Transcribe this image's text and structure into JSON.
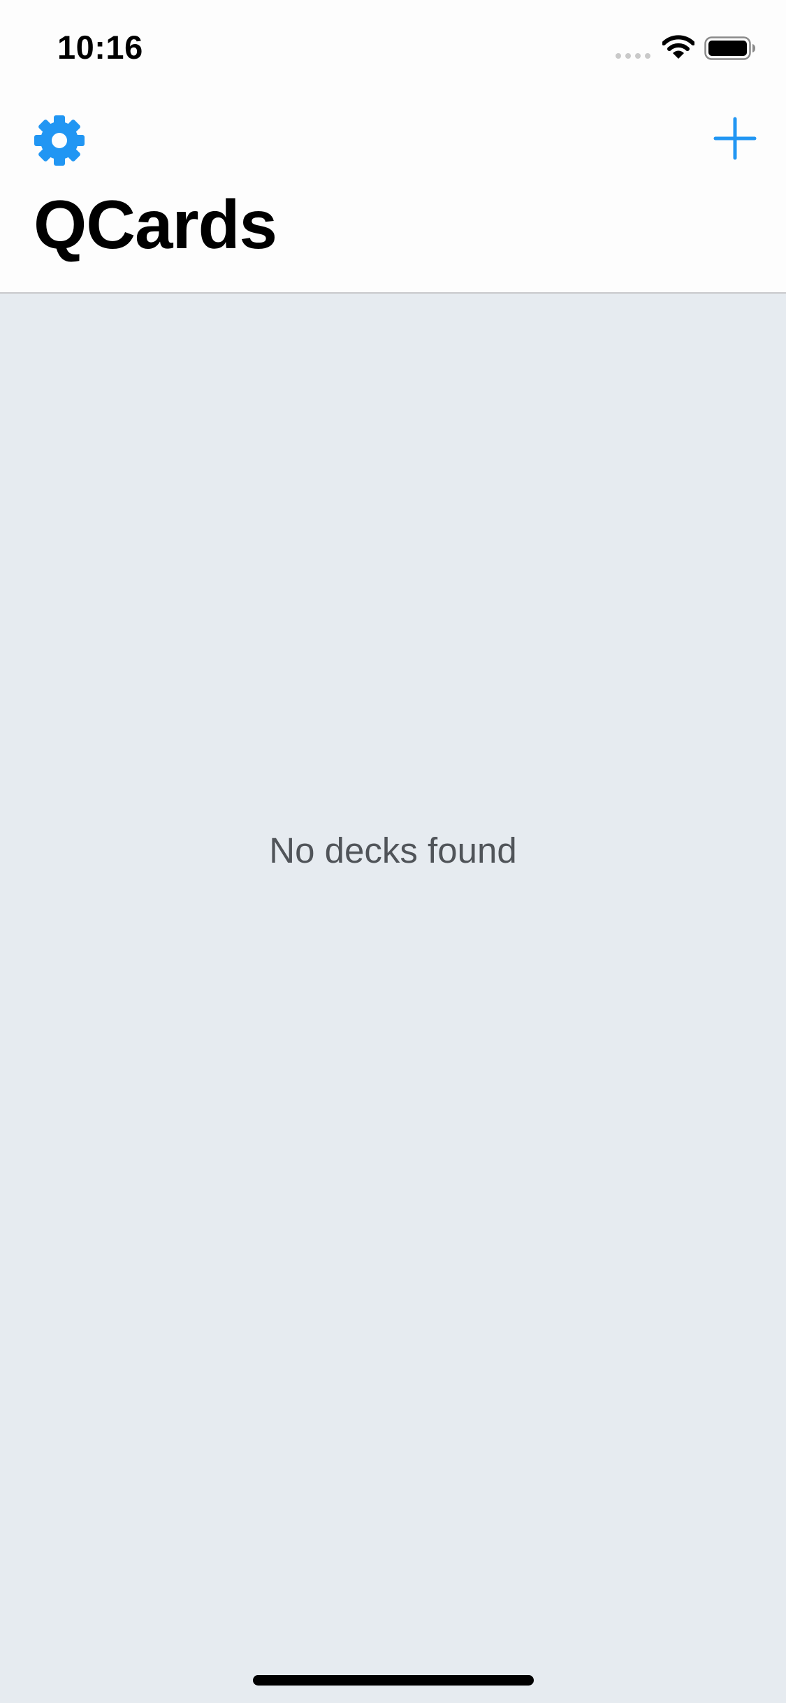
{
  "status_bar": {
    "time": "10:16"
  },
  "nav": {
    "settings_icon": "gear-icon",
    "add_icon": "plus-icon",
    "title": "QCards"
  },
  "main": {
    "empty_message": "No decks found"
  },
  "colors": {
    "accent": "#2196F3",
    "header_background": "#FDFDFD",
    "content_background": "#E6EBF0",
    "empty_text": "#505459"
  }
}
